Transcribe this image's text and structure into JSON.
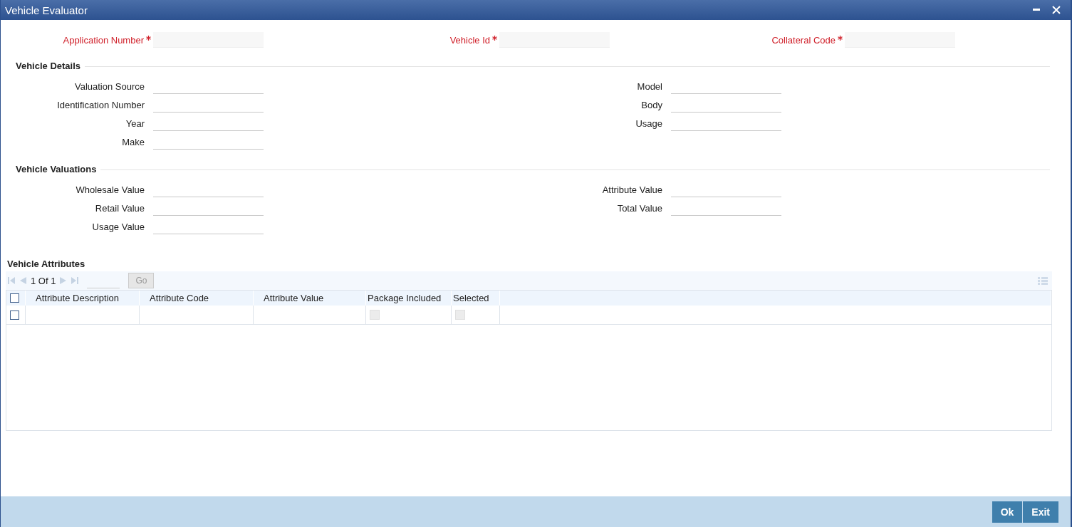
{
  "window": {
    "title": "Vehicle Evaluator"
  },
  "header_fields": [
    {
      "label": "Application Number",
      "required": true
    },
    {
      "label": "Vehicle Id",
      "required": true
    },
    {
      "label": "Collateral Code",
      "required": true
    }
  ],
  "sections": [
    {
      "title": "Vehicle Details",
      "left": [
        "Valuation Source",
        "Identification Number",
        "Year",
        "Make"
      ],
      "right": [
        "Model",
        "Body",
        "Usage"
      ]
    },
    {
      "title": "Vehicle Valuations",
      "left": [
        "Wholesale Value",
        "Retail Value",
        "Usage Value"
      ],
      "right": [
        "Attribute Value",
        "Total Value"
      ]
    }
  ],
  "attributes": {
    "title": "Vehicle Attributes",
    "pager": "1 Of 1",
    "go_button": {
      "label": "Go",
      "disabled": true
    },
    "columns": [
      "Attribute Description",
      "Attribute Code",
      "Attribute Value",
      "Package Included",
      "Selected"
    ],
    "select_all_checked": false,
    "rows": [
      {
        "checked": false,
        "package_included": false,
        "selected": false
      }
    ]
  },
  "buttons": [
    "Ok",
    "Exit"
  ]
}
